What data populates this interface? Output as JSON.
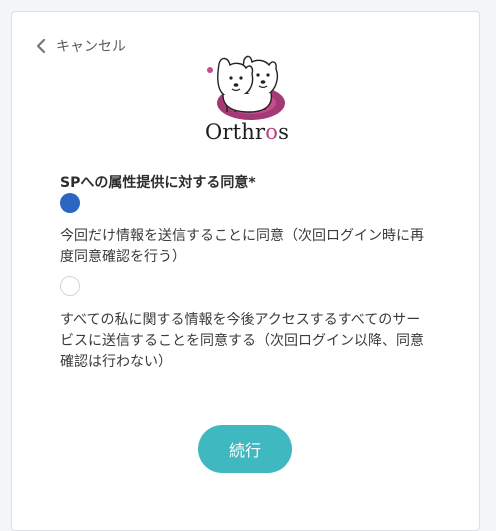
{
  "nav": {
    "cancel_label": "キャンセル"
  },
  "logo": {
    "text_main": "Orthr",
    "text_accent": "o",
    "text_end": "s",
    "accent_color": "#bc3d82"
  },
  "form": {
    "heading": "SPへの属性提供に対する同意*",
    "options": [
      {
        "label": "今回だけ情報を送信することに同意（次回ログイン時に再度同意確認を行う）",
        "selected": true
      },
      {
        "label": "すべての私に関する情報を今後アクセスするすべてのサービスに送信することを同意する（次回ログイン以降、同意確認は行わない）",
        "selected": false
      }
    ],
    "submit_label": "続行"
  },
  "colors": {
    "radio_selected": "#2b66c3",
    "button": "#40b8bf"
  },
  "icons": {
    "back": "chevron-left-icon",
    "logo": "orthros-dog-logo"
  }
}
